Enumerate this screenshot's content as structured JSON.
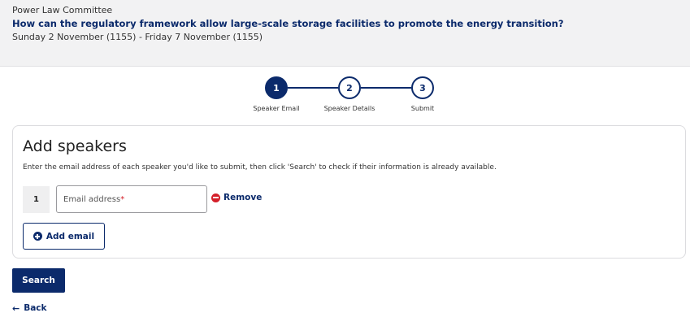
{
  "header": {
    "committee": "Power Law Committee",
    "title": "How can the regulatory framework allow large-scale storage facilities to promote the energy transition?",
    "dates": "Sunday 2 November (1155) - Friday 7 November (1155)"
  },
  "stepper": {
    "steps": [
      {
        "number": "1",
        "label": "Speaker Email",
        "active": true
      },
      {
        "number": "2",
        "label": "Speaker Details",
        "active": false
      },
      {
        "number": "3",
        "label": "Submit",
        "active": false
      }
    ]
  },
  "card": {
    "heading": "Add speakers",
    "instructions": "Enter the email address of each speaker you'd like to submit, then click 'Search' to check if their information is already available.",
    "rows": [
      {
        "number": "1",
        "email_placeholder": "Email address",
        "required_marker": "*",
        "value": ""
      }
    ],
    "remove_label": "Remove",
    "add_email_label": "Add email"
  },
  "actions": {
    "search_label": "Search",
    "back_label": "Back"
  },
  "colors": {
    "brand_navy": "#0b2a6b",
    "danger_red": "#d4202a",
    "header_bg": "#f2f2f3"
  },
  "icons": {
    "remove": "minus-circle-icon",
    "add": "plus-circle-icon",
    "back": "arrow-left-icon"
  }
}
